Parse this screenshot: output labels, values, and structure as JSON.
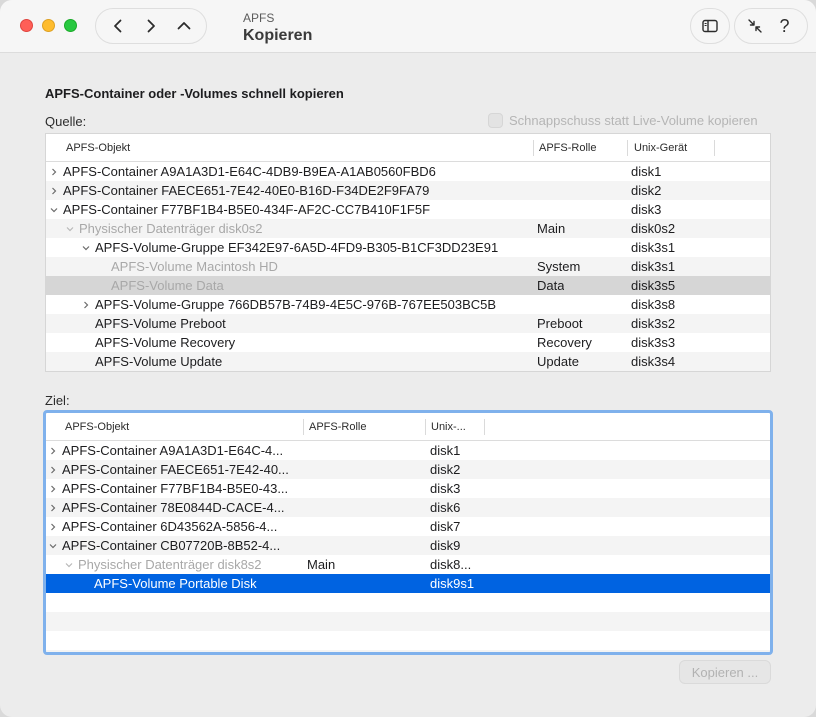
{
  "window": {
    "subtitle": "APFS",
    "title": "Kopieren"
  },
  "toolbar": {
    "help_label": "?"
  },
  "heading": "APFS-Container oder -Volumes schnell kopieren",
  "source": {
    "label": "Quelle:",
    "snapshot_label": "Schnappschuss statt Live-Volume kopieren",
    "columns": [
      "APFS-Objekt",
      "APFS-Rolle",
      "Unix-Gerät"
    ],
    "rows": [
      {
        "name": "APFS-Container A9A1A3D1-E64C-4DB9-B9EA-A1AB0560FBD6",
        "role": "",
        "device": "disk1"
      },
      {
        "name": "APFS-Container FAECE651-7E42-40E0-B16D-F34DE2F9FA79",
        "role": "",
        "device": "disk2"
      },
      {
        "name": "APFS-Container F77BF1B4-B5E0-434F-AF2C-CC7B410F1F5F",
        "role": "",
        "device": "disk3"
      },
      {
        "name": "Physischer Datenträger disk0s2",
        "role": "Main",
        "device": "disk0s2"
      },
      {
        "name": "APFS-Volume-Gruppe EF342E97-6A5D-4FD9-B305-B1CF3DD23E91",
        "role": "",
        "device": "disk3s1"
      },
      {
        "name": "APFS-Volume Macintosh HD",
        "role": "System",
        "device": "disk3s1"
      },
      {
        "name": "APFS-Volume Data",
        "role": "Data",
        "device": "disk3s5"
      },
      {
        "name": "APFS-Volume-Gruppe 766DB57B-74B9-4E5C-976B-767EE503BC5B",
        "role": "",
        "device": "disk3s8"
      },
      {
        "name": "APFS-Volume Preboot",
        "role": "Preboot",
        "device": "disk3s2"
      },
      {
        "name": "APFS-Volume Recovery",
        "role": "Recovery",
        "device": "disk3s3"
      },
      {
        "name": "APFS-Volume Update",
        "role": "Update",
        "device": "disk3s4"
      }
    ]
  },
  "target": {
    "label": "Ziel:",
    "columns": [
      "APFS-Objekt",
      "APFS-Rolle",
      "Unix-..."
    ],
    "rows": [
      {
        "name": "APFS-Container A9A1A3D1-E64C-4...",
        "role": "",
        "device": "disk1"
      },
      {
        "name": "APFS-Container FAECE651-7E42-40...",
        "role": "",
        "device": "disk2"
      },
      {
        "name": "APFS-Container F77BF1B4-B5E0-43...",
        "role": "",
        "device": "disk3"
      },
      {
        "name": "APFS-Container 78E0844D-CACE-4...",
        "role": "",
        "device": "disk6"
      },
      {
        "name": "APFS-Container 6D43562A-5856-4...",
        "role": "",
        "device": "disk7"
      },
      {
        "name": "APFS-Container CB07720B-8B52-4...",
        "role": "",
        "device": "disk9"
      },
      {
        "name": "Physischer Datenträger disk8s2",
        "role": "Main",
        "device": "disk8..."
      },
      {
        "name": "APFS-Volume Portable Disk",
        "role": "",
        "device": "disk9s1"
      }
    ]
  },
  "copy_button": "Kopieren ..."
}
